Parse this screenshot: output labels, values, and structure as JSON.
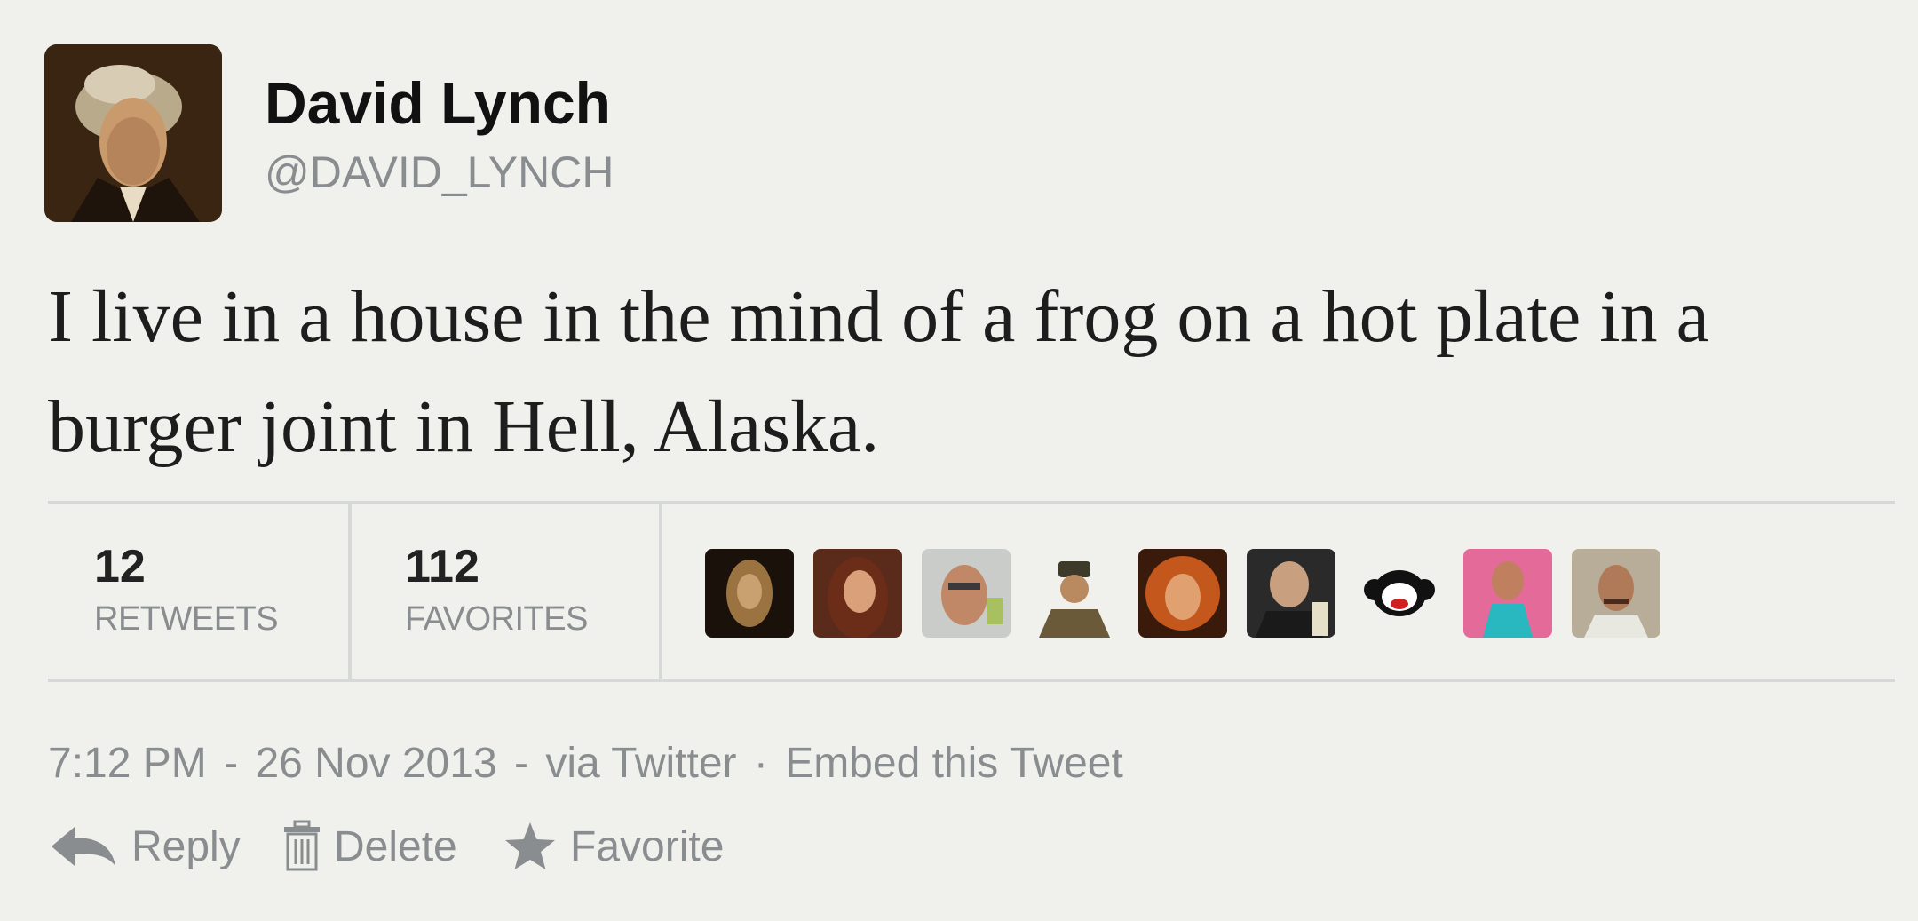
{
  "user": {
    "name": "David Lynch",
    "handle": "@DAVID_LYNCH",
    "avatar_icon": "profile-photo"
  },
  "tweet": {
    "text": "I live in a house in the mind of a frog on a hot plate in a burger joint in Hell, Alaska."
  },
  "stats": {
    "retweets_count": "12",
    "retweets_label": "RETWEETS",
    "favorites_count": "112",
    "favorites_label": "FAVORITES"
  },
  "favoriters": [
    {
      "icon": "user-avatar-1"
    },
    {
      "icon": "user-avatar-2"
    },
    {
      "icon": "user-avatar-3"
    },
    {
      "icon": "user-avatar-4"
    },
    {
      "icon": "user-avatar-5"
    },
    {
      "icon": "user-avatar-6"
    },
    {
      "icon": "user-avatar-7"
    },
    {
      "icon": "user-avatar-8"
    },
    {
      "icon": "user-avatar-9"
    }
  ],
  "meta": {
    "time": "7:12 PM",
    "date": "26 Nov 2013",
    "via": "via Twitter",
    "embed": "Embed this Tweet"
  },
  "actions": {
    "reply": "Reply",
    "delete": "Delete",
    "favorite": "Favorite"
  },
  "colors": {
    "background": "#f0f0ec",
    "muted_text": "#8a8d90",
    "divider": "#d7d9d8"
  }
}
